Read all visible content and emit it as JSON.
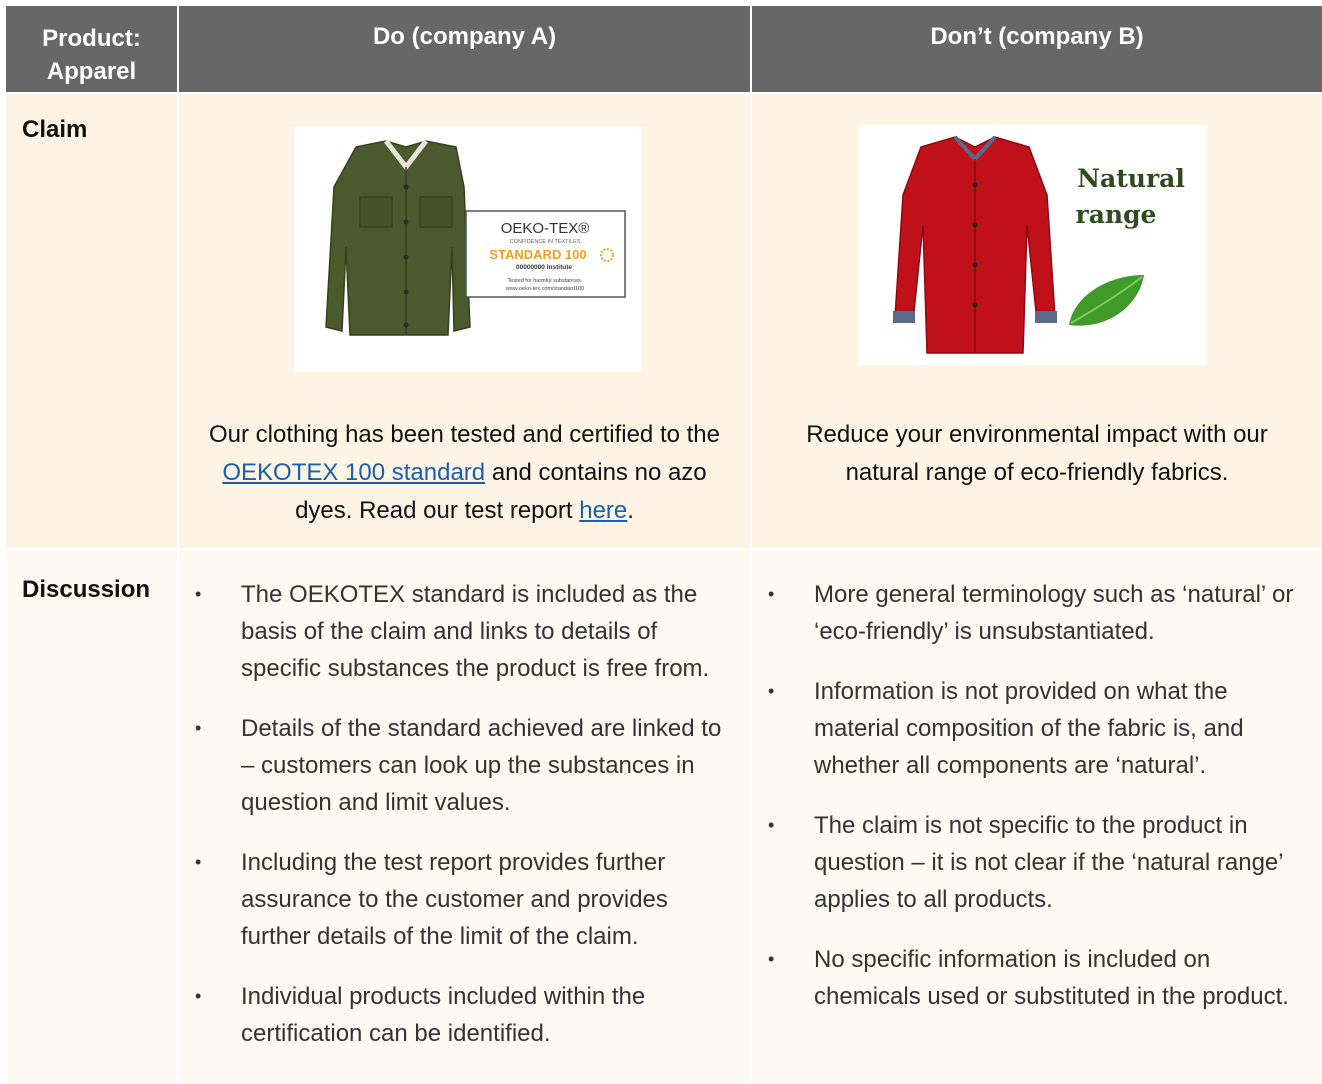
{
  "header": {
    "col_product": "Product: Apparel",
    "col_do": "Do (company A)",
    "col_dont": "Don’t (company B)"
  },
  "rows": {
    "claim_label": "Claim",
    "discussion_label": "Discussion"
  },
  "do_image": {
    "badge_title": "OEKO-TEX®",
    "badge_sub": "CONFIDENCE IN TEXTILES",
    "badge_standard": "STANDARD 100",
    "badge_number": "00000000 Institute",
    "badge_note": "Tested for harmful substances.",
    "badge_url": "www.oeko-tex.com/standard100",
    "shirt_color": "#4b5a2c"
  },
  "dont_image": {
    "caption_line1": "Natural",
    "caption_line2": "range",
    "shirt_color": "#c0111b",
    "leaf_color": "#3f9a2a"
  },
  "do_claim": {
    "part1": "Our clothing has been tested and certified to the ",
    "link1": "OEKOTEX 100 standard",
    "part2": " and contains no azo dyes. Read our test report ",
    "link2": "here",
    "part3": "."
  },
  "dont_claim": {
    "text": "Reduce your environmental impact with our natural range of eco-friendly fabrics."
  },
  "do_discussion": [
    "The OEKOTEX standard is included as the basis of the claim and links to details of specific substances the product is free from.",
    "Details of the standard achieved are linked to – customers can look up the substances in question and limit values.",
    "Including the test report provides further assurance to the customer and provides further details of the limit of the claim.",
    "Individual products included within the certification can be identified."
  ],
  "dont_discussion": [
    "More general terminology such as ‘natural’ or ‘eco-friendly’ is unsubstantiated.",
    "Information is not provided on what the material composition of the fabric is, and whether all components are ‘natural’.",
    "The claim is not specific to the product in question – it is not clear if the ‘natural range’ applies to all products.",
    "No specific information is included on chemicals used or substituted in the product."
  ],
  "colors": {
    "header_bg": "#676767",
    "claim_row_bg": "#fdf4e6",
    "discussion_row_bg": "#fdfaf4",
    "link": "#1a5fae",
    "standard_orange": "#f0a01e",
    "natural_text": "#2f4a1e"
  }
}
